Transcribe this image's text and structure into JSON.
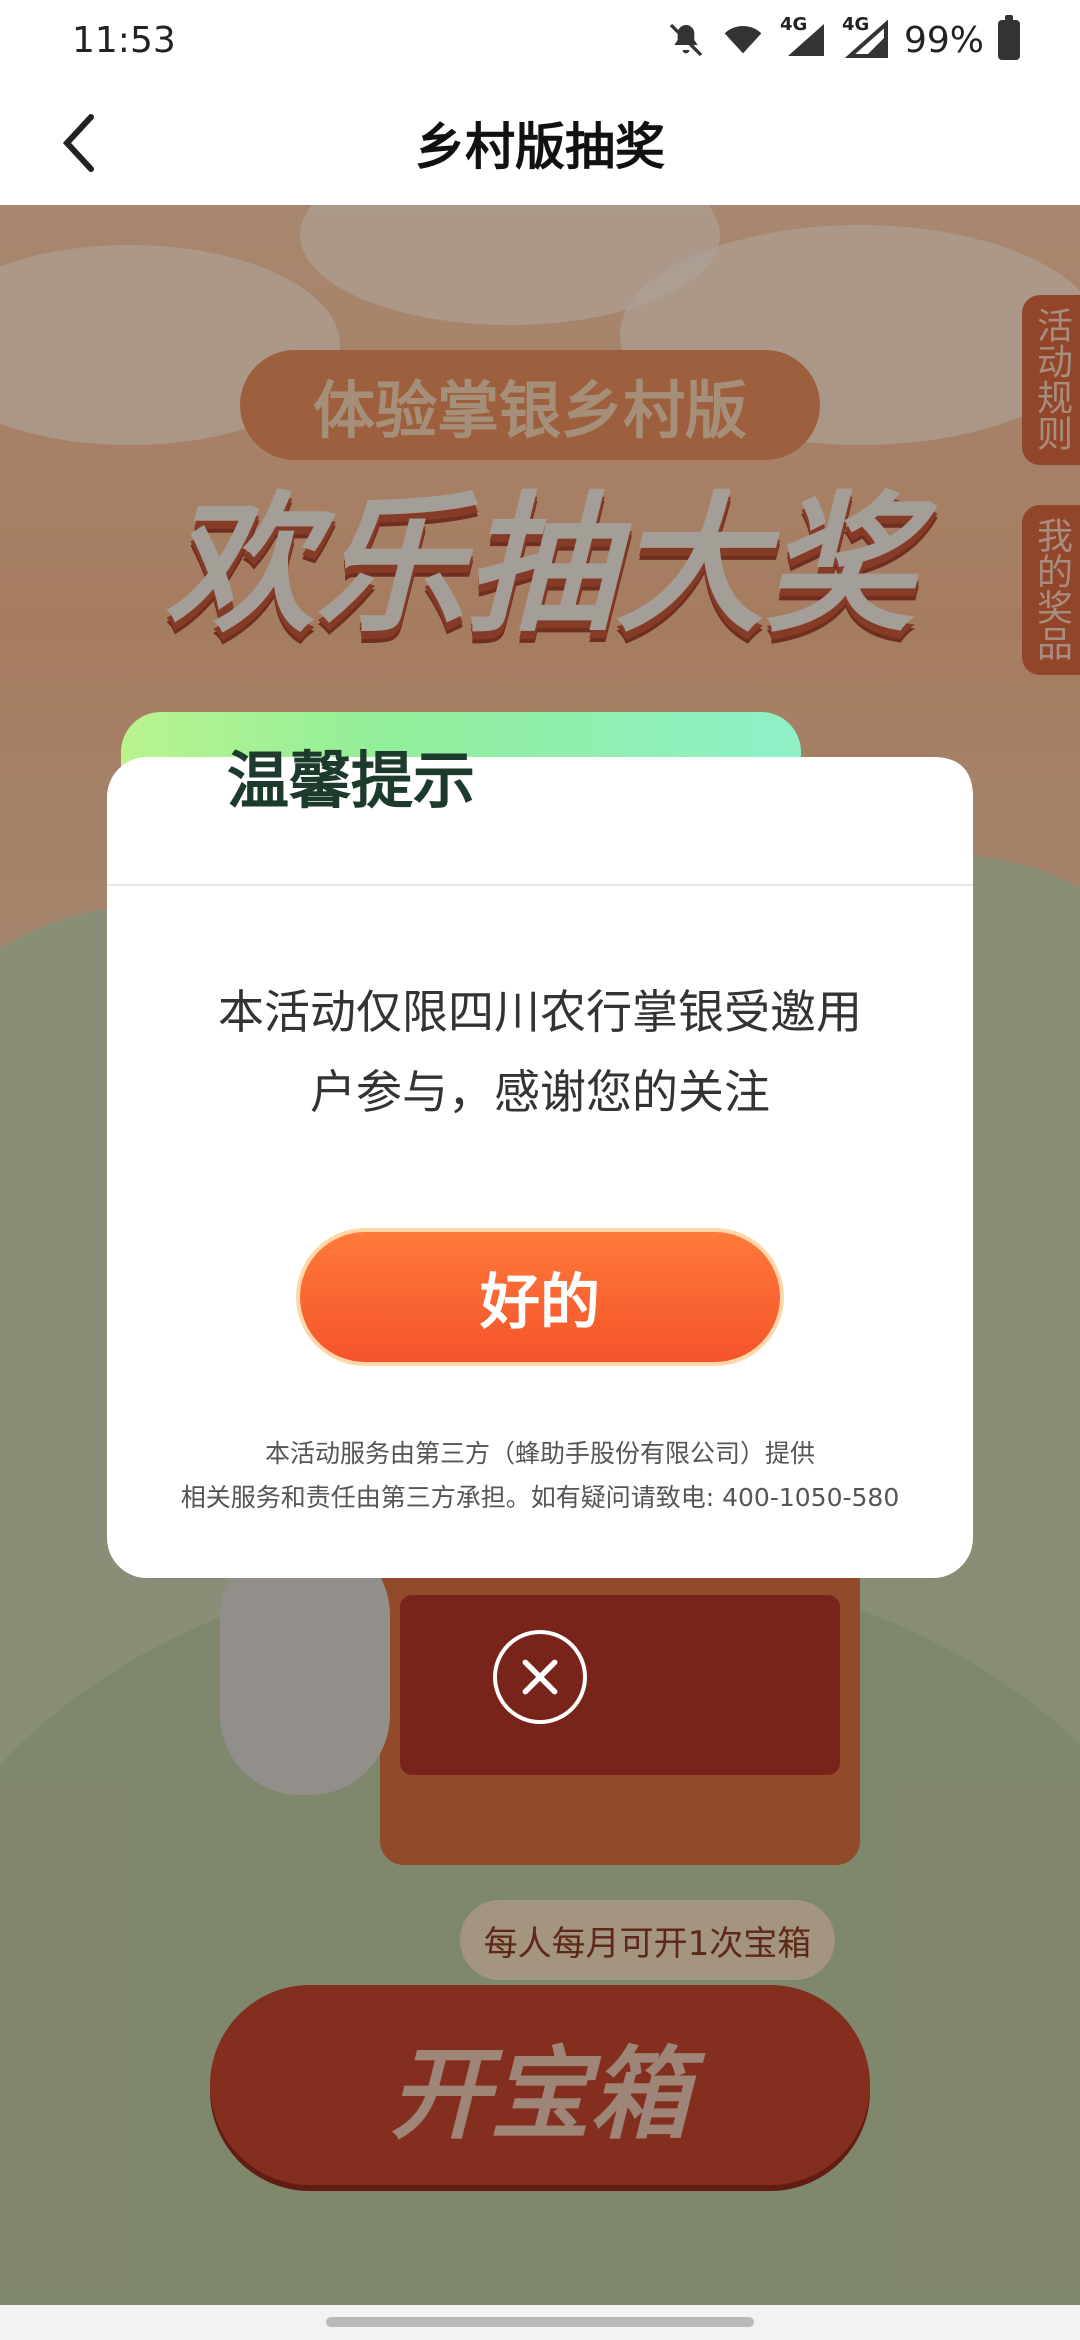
{
  "status_bar": {
    "time": "11:53",
    "icons": [
      "mute-icon",
      "wifi-icon",
      "4g-signal-icon",
      "4g-signal-icon"
    ],
    "signal_labels": [
      "4G",
      "4G"
    ],
    "battery_percent": "99%"
  },
  "nav": {
    "title": "乡村版抽奖",
    "back_icon": "chevron-left-icon"
  },
  "background": {
    "banner_subtitle": "体验掌银乡村版",
    "banner_title": "欢乐抽大奖",
    "side_tabs": [
      "活动规则",
      "我的奖品"
    ],
    "tip_pill": "每人每月可开1次宝箱",
    "open_button": "开宝箱"
  },
  "dialog": {
    "title": "温馨提示",
    "message_line1": "本活动仅限四川农行掌银受邀用",
    "message_line2": "户参与，感谢您的关注",
    "ok_button": "好的",
    "footer_line1": "本活动服务由第三方（蜂助手股份有限公司）提供",
    "footer_line2": "相关服务和责任由第三方承担。如有疑问请致电: 400-1050-580",
    "close_icon": "close-icon"
  },
  "colors": {
    "accent_orange": "#f4532a",
    "title_green_start": "#b9f48e",
    "title_green_end": "#8ef0c8"
  }
}
